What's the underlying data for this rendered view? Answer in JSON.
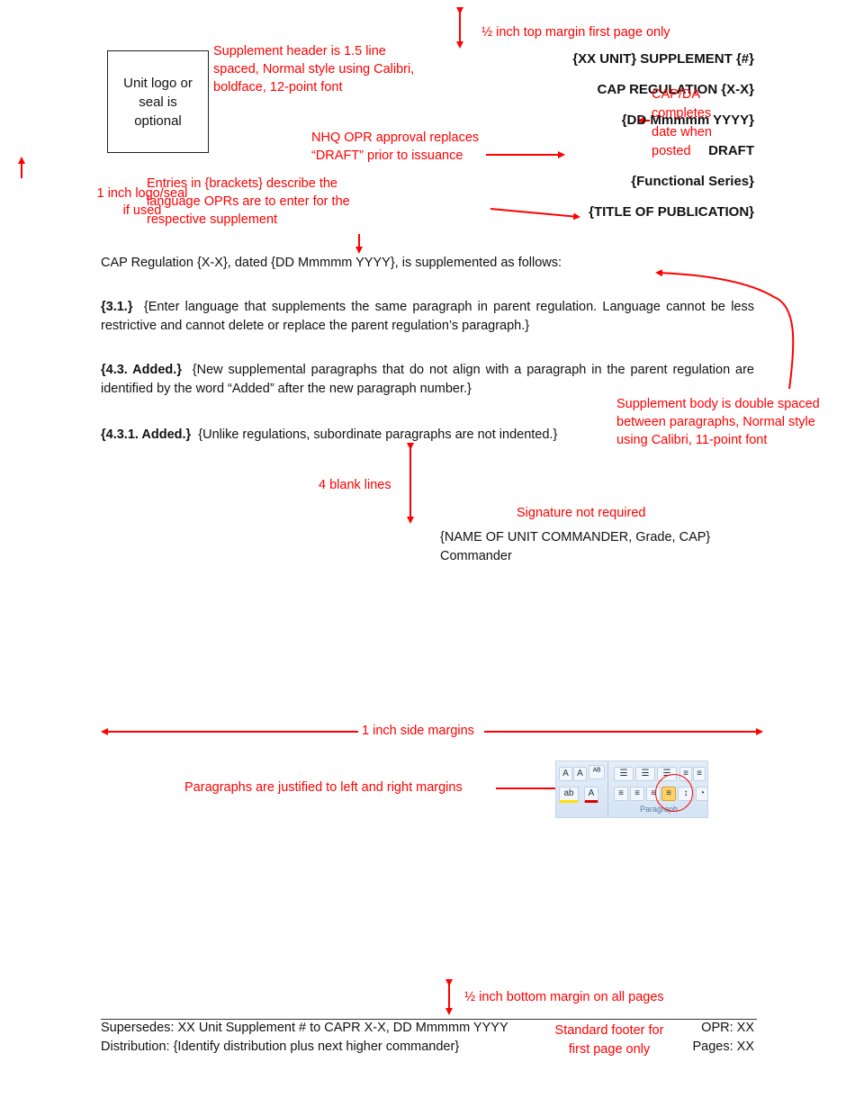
{
  "top_margin_note": "½ inch top margin first page only",
  "logo_box": {
    "text_line1": "Unit logo or",
    "text_line2": "seal is",
    "text_line3": "optional"
  },
  "header_note": {
    "line1": "Supplement header is 1.5 line",
    "line2": "spaced, Normal style using Calibri,",
    "line3": "boldface, 12-point font"
  },
  "header": {
    "unit_supplement": "{XX UNIT} SUPPLEMENT {#}",
    "regulation": "CAP REGULATION {X-X}",
    "date": "{DD Mmmmm YYYY}",
    "draft": "DRAFT",
    "functional_series": "{Functional Series}",
    "title": "{TITLE OF PUBLICATION}"
  },
  "capda_note": {
    "line1": "CAP/DA",
    "line2": "completes",
    "line3": "date when",
    "line4": "posted"
  },
  "nhq_note": {
    "line1": "NHQ OPR approval replaces",
    "line2": "“DRAFT” prior to issuance"
  },
  "logo_size_note": {
    "line1": "1 inch logo/seal",
    "line2": "if used"
  },
  "brackets_note": {
    "line1": "Entries in {brackets} describe the",
    "line2": "language OPRs are to enter for the",
    "line3": "respective supplement"
  },
  "intro": "CAP Regulation {X-X}, dated {DD Mmmmm YYYY}, is supplemented as follows:",
  "paragraphs": [
    {
      "number": "{3.1.}",
      "text": "{Enter language that supplements the same paragraph in parent regulation.  Language cannot be less restrictive and cannot delete or replace the parent regulation’s paragraph.}"
    },
    {
      "number": "{4.3.  Added.}",
      "text": "{New supplemental paragraphs that do not align with a paragraph in the parent regulation are identified by the word “Added” after the new paragraph number.}"
    },
    {
      "number": "{4.3.1. Added.}",
      "text": "{Unlike regulations, subordinate paragraphs are not indented.}"
    }
  ],
  "body_note": {
    "line1": "Supplement body is double spaced",
    "line2": "between paragraphs, Normal style",
    "line3": "using Calibri, 11-point font"
  },
  "blank_lines_note": "4 blank lines",
  "signature_note": "Signature not required",
  "signature": {
    "name": "{NAME OF UNIT COMMANDER, Grade, CAP}",
    "title": "Commander"
  },
  "side_margins_note": "1 inch side margins",
  "justify_note": "Paragraphs are justified to left and right margins",
  "ribbon": {
    "group_label": "Paragraph"
  },
  "bottom_margin_note": "½ inch bottom margin on all pages",
  "footer": {
    "supersedes": "Supersedes:  XX Unit Supplement # to CAPR X-X, DD Mmmmm YYYY",
    "distribution": "Distribution:  {Identify distribution plus next higher commander}",
    "note_line1": "Standard footer for",
    "note_line2": "first page only",
    "opr": "OPR:  XX",
    "pages": "Pages:  XX"
  },
  "colors": {
    "annotation": "#ff0000",
    "text": "#111111"
  }
}
